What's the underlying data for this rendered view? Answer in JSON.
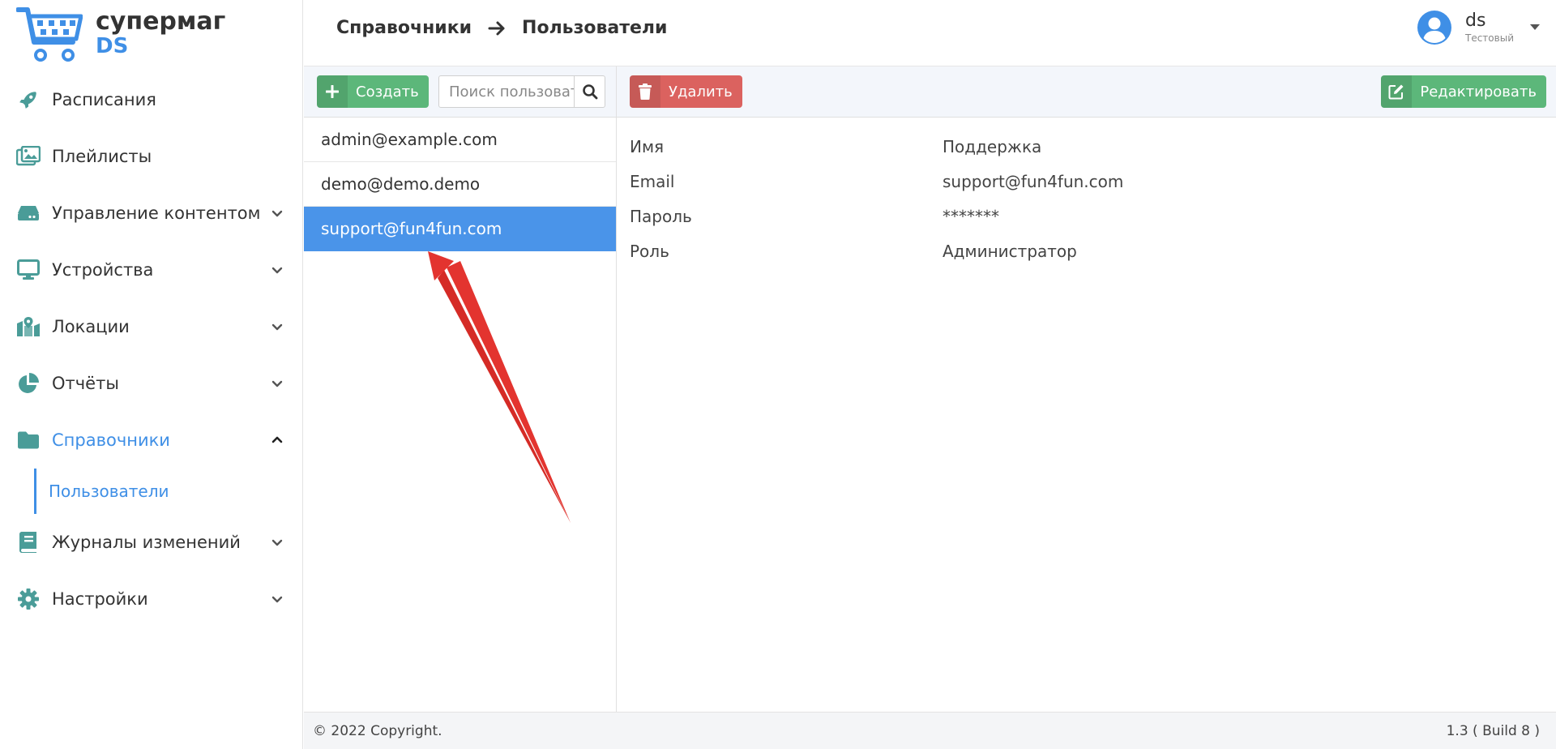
{
  "logo": {
    "title": "супермаг",
    "subtitle": "DS"
  },
  "colors": {
    "accent": "#3f8fe6",
    "primary_green": "#5cb77a",
    "danger": "#d9534f",
    "selected_row": "#4a94e9",
    "icon_teal": "#4a9c98"
  },
  "sidebar": {
    "items": [
      {
        "label": "Расписания",
        "icon": "rocket-icon",
        "expandable": false
      },
      {
        "label": "Плейлисты",
        "icon": "images-icon",
        "expandable": false
      },
      {
        "label": "Управление контентом",
        "icon": "hdd-icon",
        "expandable": true
      },
      {
        "label": "Устройства",
        "icon": "monitor-icon",
        "expandable": true
      },
      {
        "label": "Локации",
        "icon": "map-icon",
        "expandable": true
      },
      {
        "label": "Отчёты",
        "icon": "pie-chart-icon",
        "expandable": true
      },
      {
        "label": "Справочники",
        "icon": "folder-icon",
        "expandable": true,
        "expanded": true,
        "active": true
      },
      {
        "label": "Журналы изменений",
        "icon": "book-icon",
        "expandable": true
      },
      {
        "label": "Настройки",
        "icon": "gear-icon",
        "expandable": true
      }
    ],
    "subitems": [
      {
        "label": "Пользователи",
        "active": true
      }
    ]
  },
  "header": {
    "breadcrumb": [
      "Справочники",
      "Пользователи"
    ],
    "user": {
      "name": "ds",
      "role": "Тестовый"
    }
  },
  "toolbar": {
    "create_label": "Создать",
    "search_placeholder": "Поиск пользователя",
    "delete_label": "Удалить",
    "edit_label": "Редактировать"
  },
  "users": [
    {
      "email": "admin@example.com",
      "selected": false
    },
    {
      "email": "demo@demo.demo",
      "selected": false
    },
    {
      "email": "support@fun4fun.com",
      "selected": true
    }
  ],
  "details": [
    {
      "key": "Имя",
      "value": "Поддержка"
    },
    {
      "key": "Email",
      "value": "support@fun4fun.com"
    },
    {
      "key": "Пароль",
      "value": "*******"
    },
    {
      "key": "Роль",
      "value": "Администратор"
    }
  ],
  "footer": {
    "copyright": "© 2022 Copyright.",
    "version": "1.3 ( Build 8 )"
  }
}
